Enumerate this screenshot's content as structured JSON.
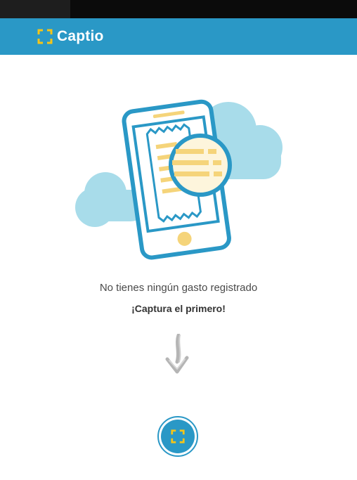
{
  "app": {
    "name": "Captio",
    "brand_color": "#2a98c6",
    "accent_color": "#f5c518"
  },
  "header": {
    "logo_text": "Captio",
    "logo_icon": "capture-frame-icon"
  },
  "illustration": {
    "icon": "phone-receipt-scan-illustration"
  },
  "empty_state": {
    "message": "No tienes ningún gasto registrado",
    "cta": "¡Captura el primero!",
    "arrow_icon": "down-arrow-icon"
  },
  "capture_button": {
    "icon": "capture-frame-icon"
  }
}
